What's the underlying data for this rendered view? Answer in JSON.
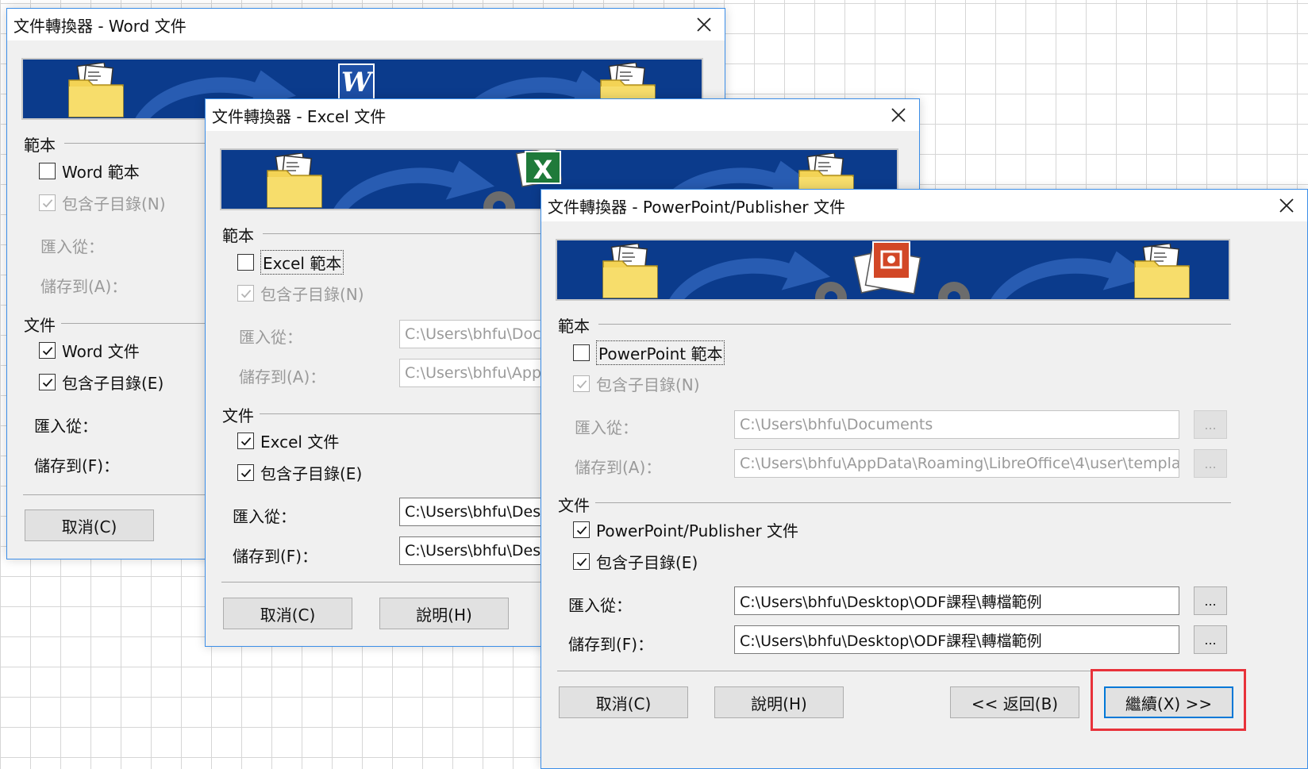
{
  "colors": {
    "accent": "#0078d7",
    "banner": "#0b3b8c",
    "highlight": "#e8323a"
  },
  "word": {
    "title": "文件轉換器 - Word 文件",
    "templates_label": "範本",
    "templates_check": "Word 範本",
    "subdir_n": "包含子目錄(N)",
    "import_label": "匯入從：",
    "save_label_a": "儲存到(A)：",
    "documents_label": "文件",
    "documents_check": "Word 文件",
    "subdir_e": "包含子目錄(E)",
    "import_label2": "匯入從：",
    "save_label_f": "儲存到(F)：",
    "cancel": "取消(C)"
  },
  "excel": {
    "title": "文件轉換器 - Excel 文件",
    "templates_label": "範本",
    "templates_check": "Excel 範本",
    "subdir_n": "包含子目錄(N)",
    "import_label": "匯入從：",
    "import_path": "C:\\Users\\bhfu\\Doc",
    "save_label_a": "儲存到(A)：",
    "save_path": "C:\\Users\\bhfu\\App",
    "documents_label": "文件",
    "documents_check": "Excel 文件",
    "subdir_e": "包含子目錄(E)",
    "import_label2": "匯入從：",
    "import_path2": "C:\\Users\\bhfu\\Desk",
    "save_label_f": "儲存到(F)：",
    "save_path2": "C:\\Users\\bhfu\\Desk",
    "cancel": "取消(C)",
    "help": "說明(H)"
  },
  "ppt": {
    "title": "文件轉換器 - PowerPoint/Publisher 文件",
    "templates_label": "範本",
    "templates_check": "PowerPoint 範本",
    "subdir_n": "包含子目錄(N)",
    "import_label": "匯入從：",
    "import_path": "C:\\Users\\bhfu\\Documents",
    "save_label_a": "儲存到(A)：",
    "save_path": "C:\\Users\\bhfu\\AppData\\Roaming\\LibreOffice\\4\\user\\templa",
    "documents_label": "文件",
    "documents_check": "PowerPoint/Publisher 文件",
    "subdir_e": "包含子目錄(E)",
    "import_label2": "匯入從：",
    "import_path2": "C:\\Users\\bhfu\\Desktop\\ODF課程\\轉檔範例",
    "save_label_f": "儲存到(F)：",
    "save_path2": "C:\\Users\\bhfu\\Desktop\\ODF課程\\轉檔範例",
    "browse": "...",
    "cancel": "取消(C)",
    "help": "說明(H)",
    "back": "<< 返回(B)",
    "next": "繼續(X) >>"
  }
}
